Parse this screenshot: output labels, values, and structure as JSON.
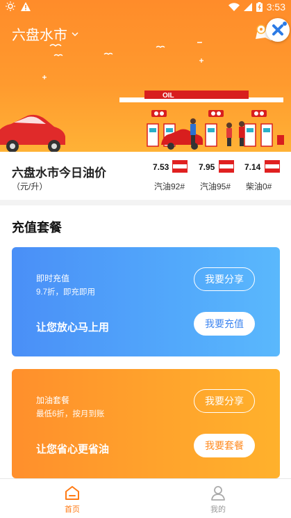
{
  "status_bar": {
    "time": "3:53"
  },
  "header": {
    "city": "六盘水市"
  },
  "scene": {
    "sign_text": "OIL"
  },
  "prices": {
    "title": "六盘水市今日油价",
    "unit": "（元/升）",
    "items": [
      {
        "value": "7.53",
        "name": "汽油92#"
      },
      {
        "value": "7.95",
        "name": "汽油95#"
      },
      {
        "value": "7.14",
        "name": "柴油0#"
      }
    ]
  },
  "section": {
    "title": "充值套餐"
  },
  "packages": [
    {
      "title": "即时充值",
      "desc": "9.7折，即充即用",
      "slogan": "让您放心马上用",
      "share_label": "我要分享",
      "action_label": "我要充值"
    },
    {
      "title": "加油套餐",
      "desc": "最低6折，按月到账",
      "slogan": "让您省心更省油",
      "share_label": "我要分享",
      "action_label": "我要套餐"
    }
  ],
  "tabbar": {
    "items": [
      {
        "label": "首页"
      },
      {
        "label": "我的"
      }
    ]
  },
  "colors": {
    "accent": "#ff7a14",
    "blue": "#4a8ff7",
    "orange": "#ff9a2e"
  }
}
